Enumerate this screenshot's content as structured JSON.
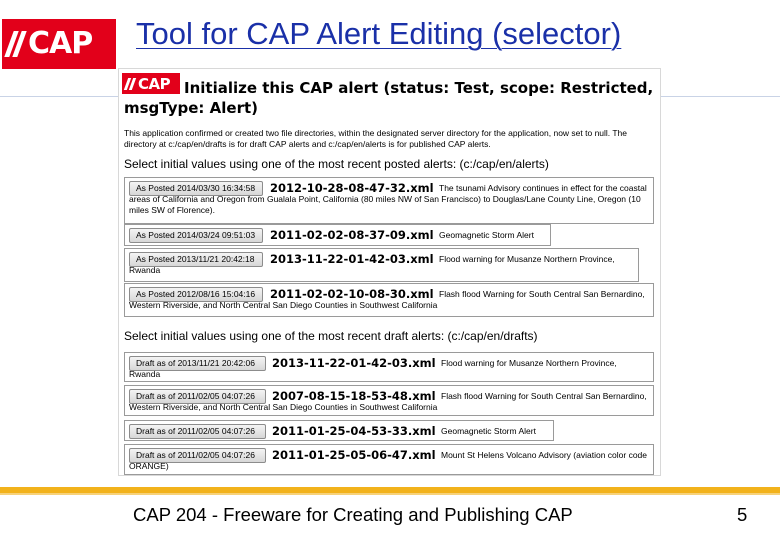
{
  "slide": {
    "logo_text": "CAP",
    "title": "Tool for CAP Alert Editing (selector)",
    "footer": "CAP 204 - Freeware for Creating and Publishing CAP",
    "page_number": "5",
    "colors": {
      "brand_red": "#e2001a",
      "title_blue": "#1a30a8",
      "footer_bar": "#f2b21b"
    }
  },
  "panel": {
    "logo_text": "CAP",
    "heading": "Initialize this CAP alert (status: Test, scope: Restricted, msgType: Alert)",
    "description": "This application confirmed or created two file directories, within the designated server directory for the application, now set to null. The directory at c:/cap/en/drafts is for draft CAP alerts and c:/cap/en/alerts is for published CAP alerts.",
    "posted_label": "Select initial values using one of the most recent posted alerts: (c:/cap/en/alerts)",
    "draft_label": "Select initial values using one of the most recent draft alerts: (c:/cap/en/drafts)",
    "posted_alerts": [
      {
        "button": "As Posted 2014/03/30 16:34:58",
        "id": "2012-10-28-08-47-32.xml",
        "description": "The tsunami Advisory continues in effect for the coastal areas of California and Oregon from Gualala Point, California (80 miles NW of San Francisco) to Douglas/Lane County Line, Oregon (10 miles SW of Florence)."
      },
      {
        "button": "As Posted 2014/03/24 09:51:03",
        "id": "2011-02-02-08-37-09.xml",
        "description": "Geomagnetic Storm Alert"
      },
      {
        "button": "As Posted 2013/11/21 20:42:18",
        "id": "2013-11-22-01-42-03.xml",
        "description": "Flood warning for Musanze Northern Province, Rwanda"
      },
      {
        "button": "As Posted 2012/08/16 15:04:16",
        "id": "2011-02-02-10-08-30.xml",
        "description": "Flash flood Warning for South Central San Bernardino, Western Riverside, and North Central San Diego Counties in Southwest California"
      }
    ],
    "draft_alerts": [
      {
        "button": "Draft as of 2013/11/21 20:42:06",
        "id": "2013-11-22-01-42-03.xml",
        "description": "Flood warning for Musanze Northern Province, Rwanda"
      },
      {
        "button": "Draft as of 2011/02/05 04:07:26",
        "id": "2007-08-15-18-53-48.xml",
        "description": "Flash flood Warning for South Central San Bernardino, Western Riverside, and North Central San Diego Counties in Southwest California"
      },
      {
        "button": "Draft as of 2011/02/05 04:07:26",
        "id": "2011-01-25-04-53-33.xml",
        "description": "Geomagnetic Storm Alert"
      },
      {
        "button": "Draft as of 2011/02/05 04:07:26",
        "id": "2011-01-25-05-06-47.xml",
        "description": "Mount St Helens Volcano Advisory (aviation color code ORANGE)"
      }
    ]
  }
}
